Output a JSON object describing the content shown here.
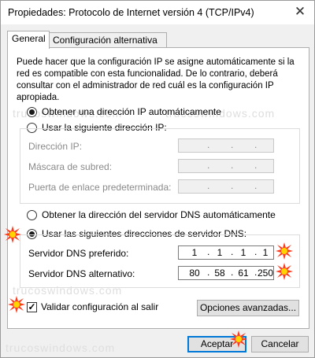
{
  "window": {
    "title": "Propiedades: Protocolo de Internet versión 4 (TCP/IPv4)",
    "close_icon": "✕"
  },
  "tabs": [
    {
      "label": "General",
      "active": true
    },
    {
      "label": "Configuración alternativa",
      "active": false
    }
  ],
  "intro_text": "Puede hacer que la configuración IP se asigne automáticamente si la red es compatible con esta funcionalidad. De lo contrario, deberá consultar con el administrador de red cuál es la configuración IP apropiada.",
  "ip_options": {
    "auto_label": "Obtener una dirección IP automáticamente",
    "auto_checked": true,
    "manual_label": "Usar la siguiente dirección IP:",
    "manual_checked": false,
    "fields": [
      {
        "label": "Dirección IP:",
        "value": [
          "",
          "",
          "",
          ""
        ]
      },
      {
        "label": "Máscara de subred:",
        "value": [
          "",
          "",
          "",
          ""
        ]
      },
      {
        "label": "Puerta de enlace predeterminada:",
        "value": [
          "",
          "",
          "",
          ""
        ]
      }
    ]
  },
  "dns_options": {
    "auto_label": "Obtener la dirección del servidor DNS automáticamente",
    "auto_checked": false,
    "manual_label": "Usar las siguientes direcciones de servidor DNS:",
    "manual_checked": true,
    "preferred": {
      "label": "Servidor DNS preferido:",
      "value": [
        "1",
        "1",
        "1",
        "1"
      ]
    },
    "alternate": {
      "label": "Servidor DNS alternativo:",
      "value": [
        "80",
        "58",
        "61",
        "250"
      ]
    }
  },
  "validate": {
    "label": "Validar configuración al salir",
    "checked": true
  },
  "buttons": {
    "advanced": "Opciones avanzadas...",
    "accept": "Aceptar",
    "cancel": "Cancelar"
  },
  "watermark": "trucoswindows.com",
  "colors": {
    "accent": "#0078d7",
    "burst": "#ff3b1f",
    "burst_core": "#ffd400"
  }
}
